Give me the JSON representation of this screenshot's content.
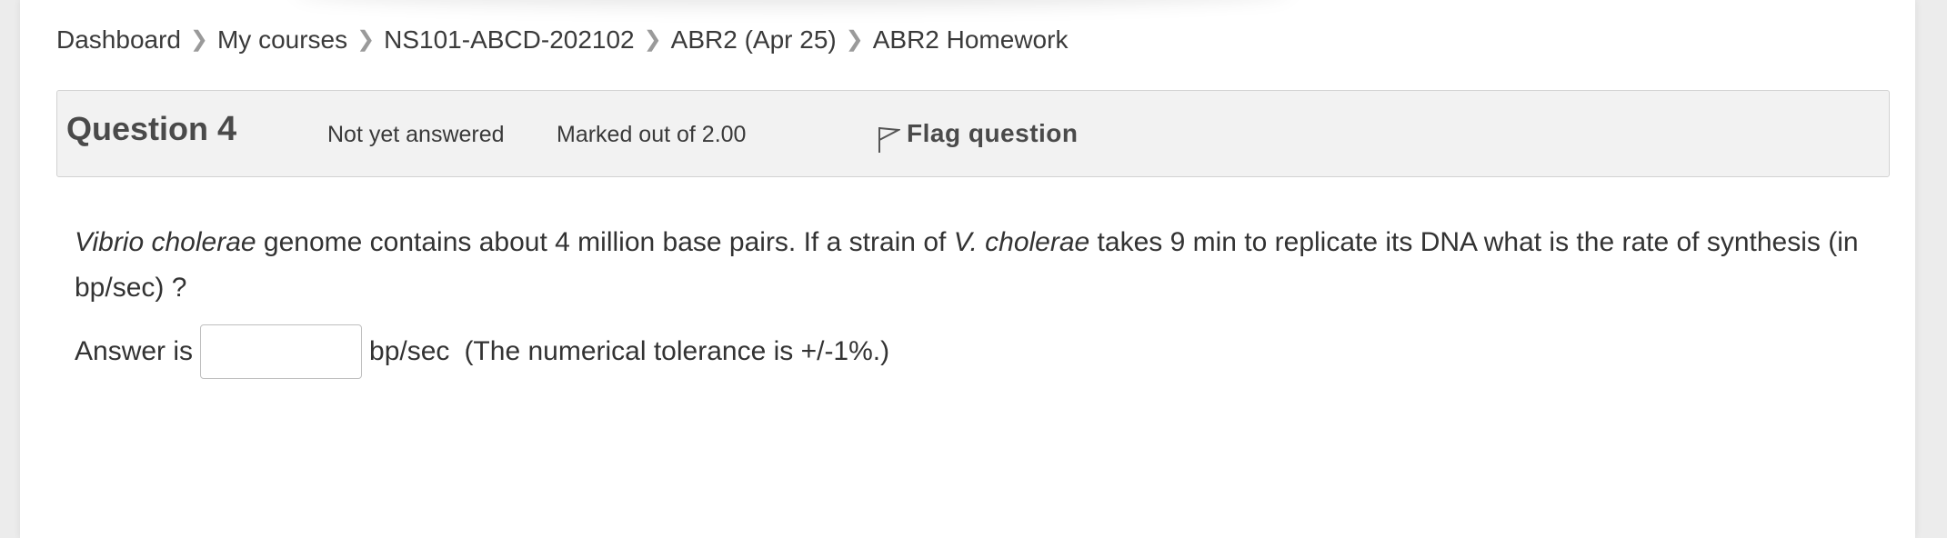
{
  "breadcrumb": {
    "items": [
      {
        "label": "Dashboard"
      },
      {
        "label": "My courses"
      },
      {
        "label": "NS101-ABCD-202102"
      },
      {
        "label": "ABR2 (Apr 25)"
      },
      {
        "label": "ABR2 Homework"
      }
    ],
    "separator_icon": "chevron-right-icon"
  },
  "question_info": {
    "title_prefix": "Question",
    "number": "4",
    "status": "Not yet answered",
    "grade": "Marked out of 2.00",
    "flag_label": "Flag question",
    "flag_icon": "flag-icon"
  },
  "question": {
    "part1_italic": "Vibrio cholerae",
    "part2": " genome contains about 4 million base pairs. If  a strain of ",
    "part3_italic": "V. cholerae",
    "part4": " takes 9 min to replicate its DNA what is the rate of synthesis (in bp/sec) ?"
  },
  "answer": {
    "prefix": "Answer is",
    "value": "",
    "unit": "bp/sec",
    "tolerance": "(The numerical tolerance is +/-1%.)"
  },
  "colors": {
    "background": "#ececec",
    "panel": "#ffffff",
    "info_box": "#f2f2f2",
    "text": "#333333"
  }
}
